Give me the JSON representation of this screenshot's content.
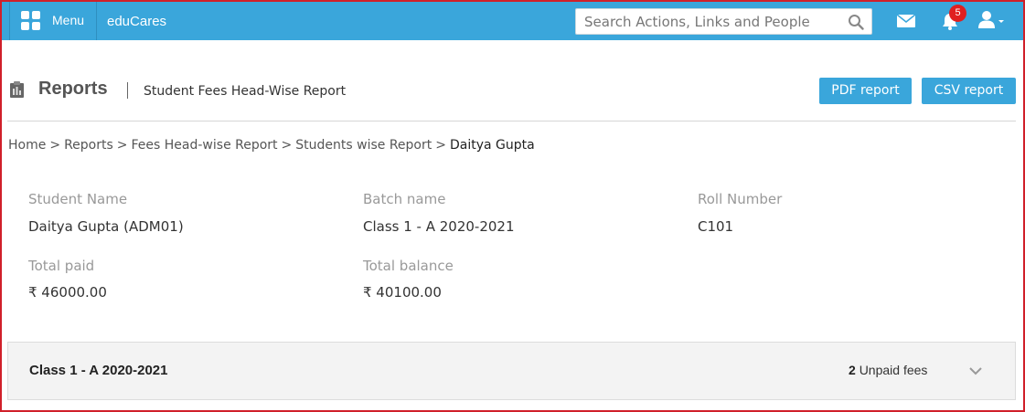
{
  "topbar": {
    "menu_label": "Menu",
    "app_name": "eduCares",
    "search_placeholder": "Search Actions, Links and People",
    "notification_count": "5",
    "accent_color": "#3aa6db",
    "icons": [
      "grid-icon",
      "search-icon",
      "mail-icon",
      "bell-icon",
      "user-icon",
      "caret-down-icon"
    ]
  },
  "header": {
    "title": "Reports",
    "subtitle": "Student Fees Head-Wise Report",
    "pdf_button": "PDF report",
    "csv_button": "CSV report",
    "icon": "clipboard-icon"
  },
  "breadcrumb": {
    "items": [
      "Home",
      "Reports",
      "Fees Head-wise Report",
      "Students wise Report"
    ],
    "separator": ">",
    "current": "Daitya Gupta"
  },
  "student": {
    "name_label": "Student Name",
    "name_value": "Daitya Gupta (ADM01)",
    "batch_label": "Batch name",
    "batch_value": "Class 1 - A 2020-2021",
    "roll_label": "Roll Number",
    "roll_value": "C101",
    "paid_label": "Total paid",
    "paid_value": "₹ 46000.00",
    "balance_label": "Total balance",
    "balance_value": "₹ 40100.00"
  },
  "batch_panel": {
    "title": "Class 1 - A 2020-2021",
    "unpaid_count": "2",
    "unpaid_label": "Unpaid fees"
  }
}
